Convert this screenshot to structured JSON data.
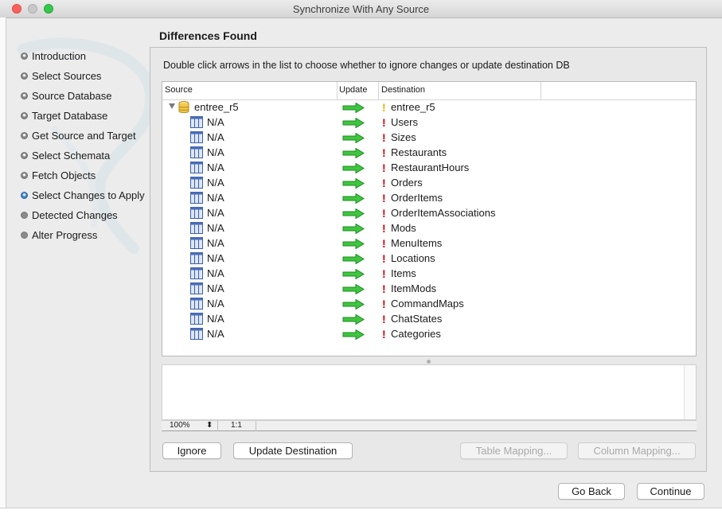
{
  "window": {
    "title": "Synchronize With Any Source"
  },
  "sidebar": {
    "steps": [
      {
        "label": "Introduction",
        "state": "done"
      },
      {
        "label": "Select Sources",
        "state": "done"
      },
      {
        "label": "Source Database",
        "state": "done"
      },
      {
        "label": "Target Database",
        "state": "done"
      },
      {
        "label": "Get Source and Target",
        "state": "done"
      },
      {
        "label": "Select Schemata",
        "state": "done"
      },
      {
        "label": "Fetch Objects",
        "state": "done"
      },
      {
        "label": "Select Changes to Apply",
        "state": "current"
      },
      {
        "label": "Detected Changes",
        "state": "pending"
      },
      {
        "label": "Alter Progress",
        "state": "pending"
      }
    ]
  },
  "main": {
    "heading": "Differences Found",
    "instructions": "Double click arrows in the list to choose whether to ignore changes or update destination DB",
    "columns": {
      "source": "Source",
      "update": "Update",
      "destination": "Destination"
    },
    "root": {
      "source": "entree_r5",
      "destination": "entree_r5",
      "flag": "!"
    },
    "rows": [
      {
        "source": "N/A",
        "flag": "!",
        "destination": "Users"
      },
      {
        "source": "N/A",
        "flag": "!",
        "destination": "Sizes"
      },
      {
        "source": "N/A",
        "flag": "!",
        "destination": "Restaurants"
      },
      {
        "source": "N/A",
        "flag": "!",
        "destination": "RestaurantHours"
      },
      {
        "source": "N/A",
        "flag": "!",
        "destination": "Orders"
      },
      {
        "source": "N/A",
        "flag": "!",
        "destination": "OrderItems"
      },
      {
        "source": "N/A",
        "flag": "!",
        "destination": "OrderItemAssociations"
      },
      {
        "source": "N/A",
        "flag": "!",
        "destination": "Mods"
      },
      {
        "source": "N/A",
        "flag": "!",
        "destination": "MenuItems"
      },
      {
        "source": "N/A",
        "flag": "!",
        "destination": "Locations"
      },
      {
        "source": "N/A",
        "flag": "!",
        "destination": "Items"
      },
      {
        "source": "N/A",
        "flag": "!",
        "destination": "ItemMods"
      },
      {
        "source": "N/A",
        "flag": "!",
        "destination": "CommandMaps"
      },
      {
        "source": "N/A",
        "flag": "!",
        "destination": "ChatStates"
      },
      {
        "source": "N/A",
        "flag": "!",
        "destination": "Categories"
      }
    ],
    "zoom": {
      "value": "100%",
      "ratio": "1:1"
    },
    "buttons": {
      "ignore": "Ignore",
      "update_destination": "Update Destination",
      "table_mapping": "Table Mapping...",
      "column_mapping": "Column Mapping..."
    }
  },
  "footer": {
    "go_back": "Go Back",
    "continue": "Continue"
  },
  "colors": {
    "root_flag": "#e8b400",
    "row_flag": "#d9000d",
    "arrow": "#2fbf32",
    "current_step": "#3a7bd5"
  }
}
